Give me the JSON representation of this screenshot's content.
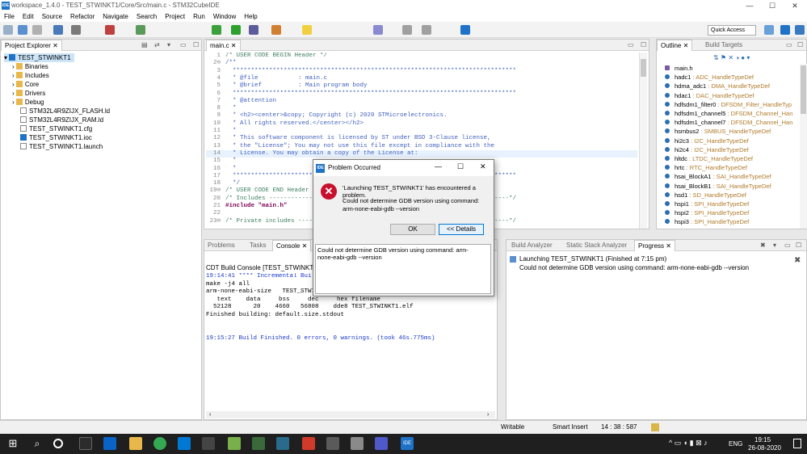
{
  "window": {
    "title": "workspace_1.4.0 - TEST_STWINKT1/Core/Src/main.c - STM32CubeIDE",
    "app_icon": "IDE",
    "minimize": "—",
    "maximize": "☐",
    "close": "✕"
  },
  "menu": [
    "File",
    "Edit",
    "Source",
    "Refactor",
    "Navigate",
    "Search",
    "Project",
    "Run",
    "Window",
    "Help"
  ],
  "quick_access": "Quick Access",
  "project_explorer": {
    "tab": "Project Explorer",
    "items": [
      {
        "label": "TEST_STWINKT1",
        "type": "project"
      },
      {
        "label": "Binaries",
        "type": "folder"
      },
      {
        "label": "Includes",
        "type": "folder"
      },
      {
        "label": "Core",
        "type": "folder"
      },
      {
        "label": "Drivers",
        "type": "folder"
      },
      {
        "label": "Debug",
        "type": "folder"
      },
      {
        "label": "STM32L4R9ZIJX_FLASH.ld",
        "type": "file"
      },
      {
        "label": "STM32L4R9ZIJX_RAM.ld",
        "type": "file"
      },
      {
        "label": "TEST_STWINKT1.cfg",
        "type": "file"
      },
      {
        "label": "TEST_STWINKT1.ioc",
        "type": "file"
      },
      {
        "label": "TEST_STWINKT1.launch",
        "type": "file"
      }
    ]
  },
  "editor": {
    "tab": "main.c",
    "lines": [
      {
        "n": "1",
        "t": "/* USER CODE BEGIN Header */",
        "c": "cm"
      },
      {
        "n": "2⊖",
        "t": "/**",
        "c": "cmb"
      },
      {
        "n": "3",
        "t": "  ******************************************************************************",
        "c": "cmb"
      },
      {
        "n": "4",
        "t": "  * @file           : main.c",
        "c": "cmb"
      },
      {
        "n": "5",
        "t": "  * @brief          : Main program body",
        "c": "cmb"
      },
      {
        "n": "6",
        "t": "  ******************************************************************************",
        "c": "cmb"
      },
      {
        "n": "7",
        "t": "  * @attention",
        "c": "cmb"
      },
      {
        "n": "8",
        "t": "  *",
        "c": "cmb"
      },
      {
        "n": "9",
        "t": "  * <h2><center>&copy; Copyright (c) 2020 STMicroelectronics.",
        "c": "cmb"
      },
      {
        "n": "10",
        "t": "  * All rights reserved.</center></h2>",
        "c": "cmb"
      },
      {
        "n": "11",
        "t": "  *",
        "c": "cmb"
      },
      {
        "n": "12",
        "t": "  * This software component is licensed by ST under BSD 3-Clause license,",
        "c": "cmb"
      },
      {
        "n": "13",
        "t": "  * the \"License\"; You may not use this file except in compliance with the",
        "c": "cmb"
      },
      {
        "n": "14",
        "t": "  * License. You may obtain a copy of the License at:",
        "c": "cmb"
      },
      {
        "n": "15",
        "t": "  *",
        "c": "cmb"
      },
      {
        "n": "16",
        "t": "  *",
        "c": "cmb"
      },
      {
        "n": "17",
        "t": "  ******************************************************************************",
        "c": "cmb"
      },
      {
        "n": "18",
        "t": "  */",
        "c": "cmb"
      },
      {
        "n": "19⊖",
        "t": "/* USER CODE END Header",
        "c": "cm"
      },
      {
        "n": "20",
        "t": "/* Includes ------------------------------------------------------------------*/",
        "c": "cm"
      },
      {
        "n": "21",
        "t": "#include \"main.h\"",
        "c": "kw"
      },
      {
        "n": "22",
        "t": "",
        "c": "cm"
      },
      {
        "n": "23⊖",
        "t": "/* Private includes ----------------------------------------------------------*/",
        "c": "cm"
      }
    ]
  },
  "outline": {
    "tabs": [
      "Outline",
      "Build Targets"
    ],
    "items": [
      {
        "name": "main.h",
        "type": ""
      },
      {
        "name": "hadc1",
        "type": "ADC_HandleTypeDef"
      },
      {
        "name": "hdma_adc1",
        "type": "DMA_HandleTypeDef"
      },
      {
        "name": "hdac1",
        "type": "DAC_HandleTypeDef"
      },
      {
        "name": "hdfsdm1_filter0",
        "type": "DFSDM_Filter_HandleTyp"
      },
      {
        "name": "hdfsdm1_channel5",
        "type": "DFSDM_Channel_Han"
      },
      {
        "name": "hdfsdm1_channel7",
        "type": "DFSDM_Channel_Han"
      },
      {
        "name": "hsmbus2",
        "type": "SMBUS_HandleTypeDef"
      },
      {
        "name": "hi2c3",
        "type": "I2C_HandleTypeDef"
      },
      {
        "name": "hi2c4",
        "type": "I2C_HandleTypeDef"
      },
      {
        "name": "hltdc",
        "type": "LTDC_HandleTypeDef"
      },
      {
        "name": "hrtc",
        "type": "RTC_HandleTypeDef"
      },
      {
        "name": "hsai_BlockA1",
        "type": "SAI_HandleTypeDef"
      },
      {
        "name": "hsai_BlockB1",
        "type": "SAI_HandleTypeDef"
      },
      {
        "name": "hsd1",
        "type": "SD_HandleTypeDef"
      },
      {
        "name": "hspi1",
        "type": "SPI_HandleTypeDef"
      },
      {
        "name": "hspi2",
        "type": "SPI_HandleTypeDef"
      },
      {
        "name": "hspi3",
        "type": "SPI_HandleTypeDef"
      }
    ]
  },
  "console": {
    "tabs": [
      "Problems",
      "Tasks",
      "Console"
    ],
    "header": "CDT Build Console [TEST_STWINKT1]",
    "lines": [
      {
        "t": "19:14:41 **** Incremental Buil",
        "c": "blue"
      },
      {
        "t": "make -j4 all",
        "c": ""
      },
      {
        "t": "arm-none-eabi-size   TEST_STWI",
        "c": ""
      },
      {
        "t": "   text    data     bss     dec     hex filename",
        "c": ""
      },
      {
        "t": "  52128      20    4660   56808    dde8 TEST_STWINKT1.elf",
        "c": ""
      },
      {
        "t": "Finished building: default.size.stdout",
        "c": ""
      },
      {
        "t": "",
        "c": ""
      },
      {
        "t": "",
        "c": ""
      },
      {
        "t": "19:15:27 Build Finished. 0 errors, 0 warnings. (took 46s.775ms)",
        "c": "blue"
      }
    ]
  },
  "progress": {
    "tabs": [
      "Build Analyzer",
      "Static Stack Analyzer",
      "Progress"
    ],
    "title": "Launching TEST_STWINKT1 (Finished at 7:15 pm)",
    "detail": "Could not determine GDB version using command: arm-none-eabi-gdb --version"
  },
  "dialog": {
    "title": "Problem Occurred",
    "message": "'Launching TEST_STWINKT1' has encountered a problem.",
    "detail_line1": "Could not determine GDB version using command:",
    "detail_line2": "arm-none-eabi-gdb --version",
    "ok": "OK",
    "details": "<< Details",
    "details_text": "Could not determine GDB version using command: arm-none-eabi-gdb --version"
  },
  "status": {
    "mode": "Writable",
    "insert": "Smart Insert",
    "position": "14 : 38 : 587"
  },
  "taskbar": {
    "lang": "ENG",
    "time": "19:15",
    "date": "26-08-2020"
  },
  "colors": {
    "accent": "#1e73c8",
    "error": "#c8102e"
  }
}
